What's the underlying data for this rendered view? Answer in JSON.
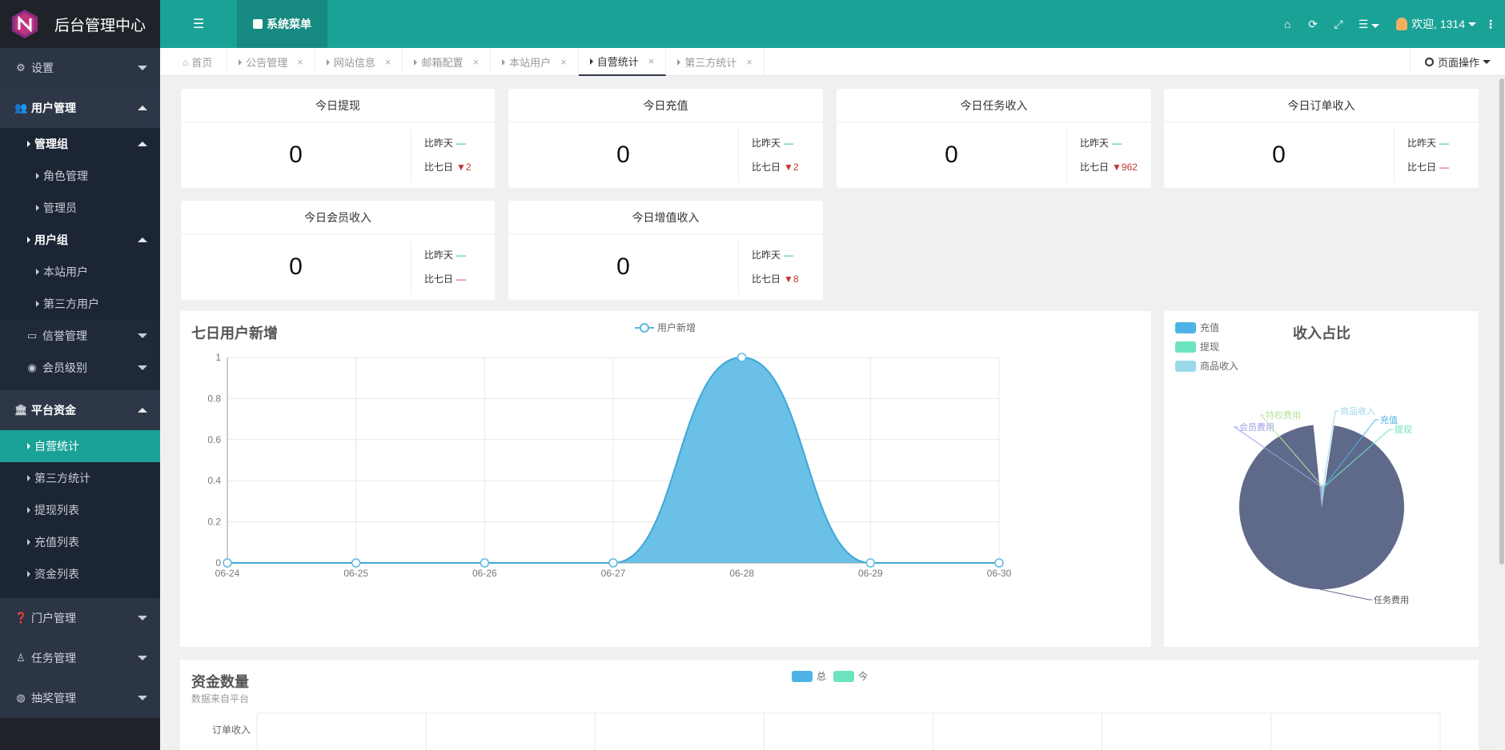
{
  "app": {
    "title": "后台管理中心"
  },
  "topbar": {
    "system_menu": "系统菜单",
    "user_label": "欢迎, 1314",
    "icons": [
      "home-icon",
      "refresh-icon",
      "fullscreen-icon",
      "list-icon"
    ]
  },
  "sidebar": {
    "settings": "设置",
    "user_mgmt": "用户管理",
    "admin_group": "管理组",
    "role_mgmt": "角色管理",
    "admin": "管理员",
    "user_group": "用户组",
    "site_users": "本站用户",
    "third_users": "第三方用户",
    "credit_mgmt": "信誉管理",
    "member_level": "会员级别",
    "platform_funds": "平台资金",
    "self_stats": "自营统计",
    "third_stats": "第三方统计",
    "withdraw_list": "提现列表",
    "recharge_list": "充值列表",
    "fund_list": "资金列表",
    "portal_mgmt": "门户管理",
    "task_mgmt": "任务管理",
    "lottery_mgmt": "抽奖管理"
  },
  "tabs": [
    {
      "label": "首页"
    },
    {
      "label": "公告管理"
    },
    {
      "label": "网站信息"
    },
    {
      "label": "邮箱配置"
    },
    {
      "label": "本站用户"
    },
    {
      "label": "自营统计"
    },
    {
      "label": "第三方统计"
    }
  ],
  "page_op": "页面操作",
  "stats": [
    {
      "title": "今日提现",
      "value": "0",
      "yesterday_label": "比昨天",
      "yesterday": "—",
      "week_label": "比七日",
      "week": "▼2"
    },
    {
      "title": "今日充值",
      "value": "0",
      "yesterday_label": "比昨天",
      "yesterday": "—",
      "week_label": "比七日",
      "week": "▼2"
    },
    {
      "title": "今日任务收入",
      "value": "0",
      "yesterday_label": "比昨天",
      "yesterday": "—",
      "week_label": "比七日",
      "week": "▼962"
    },
    {
      "title": "今日订单收入",
      "value": "0",
      "yesterday_label": "比昨天",
      "yesterday": "—",
      "week_label": "比七日",
      "week": "—"
    },
    {
      "title": "今日会员收入",
      "value": "0",
      "yesterday_label": "比昨天",
      "yesterday": "—",
      "week_label": "比七日",
      "week": "—"
    },
    {
      "title": "今日增值收入",
      "value": "0",
      "yesterday_label": "比昨天",
      "yesterday": "—",
      "week_label": "比七日",
      "week": "▼8"
    }
  ],
  "colors": {
    "accent": "#1ba297",
    "sidebar": "#20222a",
    "area": "#5ab9e3",
    "pie_main": "#5f6a8a"
  },
  "chart_data": [
    {
      "type": "area",
      "title": "七日用户新增",
      "series": [
        {
          "name": "用户新增",
          "values": [
            0,
            0,
            0,
            0,
            1,
            0,
            0
          ]
        }
      ],
      "categories": [
        "06-24",
        "06-25",
        "06-26",
        "06-27",
        "06-28",
        "06-29",
        "06-30"
      ],
      "ylim": [
        0,
        1
      ],
      "yticks": [
        "0",
        "0.2",
        "0.4",
        "0.6",
        "0.8",
        "1"
      ],
      "grid": true,
      "legend": "top-center"
    },
    {
      "type": "pie",
      "title": "收入占比",
      "legend_items": [
        "充值",
        "提现",
        "商品收入"
      ],
      "slices": [
        {
          "name": "任务费用",
          "value": 96
        },
        {
          "name": "会员费用",
          "value": 2
        },
        {
          "name": "特权费用",
          "value": 0.5
        },
        {
          "name": "商品收入",
          "value": 0.5
        },
        {
          "name": "充值",
          "value": 0.5
        },
        {
          "name": "提现",
          "value": 0.5
        }
      ],
      "legend": "top-left"
    },
    {
      "type": "bar",
      "title": "资金数量",
      "subtitle": "数据来自平台",
      "series": [
        {
          "name": "总"
        },
        {
          "name": "今"
        }
      ],
      "categories": [
        "订单收入"
      ],
      "legend": "top-center"
    }
  ]
}
